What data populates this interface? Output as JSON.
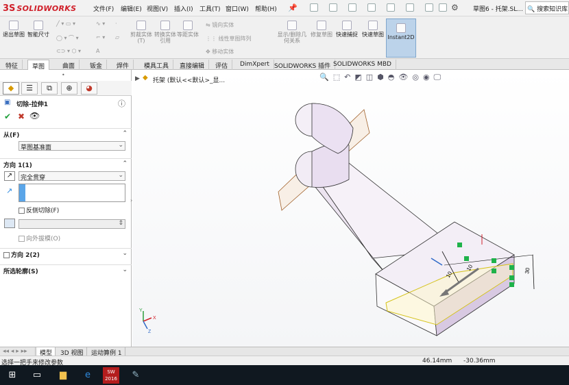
{
  "brand": {
    "logo_text": "SOLIDWORKS",
    "logo_mark": "3S"
  },
  "menubar": [
    "文件(F)",
    "编辑(E)",
    "视图(V)",
    "插入(I)",
    "工具(T)",
    "窗口(W)",
    "帮助(H)"
  ],
  "window": {
    "title": "草图6 - 托架.SL...",
    "search_placeholder": "搜索知识库"
  },
  "toolbar": {
    "left_buttons": [
      {
        "label": "退出草图"
      },
      {
        "label": "智能尺寸"
      }
    ],
    "mid_buttons": [
      {
        "label": "剪裁实体(T)"
      },
      {
        "label": "转换实体引用"
      },
      {
        "label": "等距实体"
      }
    ],
    "small_items": [
      "镜向实体",
      "线性草图阵列",
      "移动实体"
    ],
    "right_buttons": [
      {
        "label": "显示/删除几何关系"
      },
      {
        "label": "修复草图"
      },
      {
        "label": "快速捕捉"
      },
      {
        "label": "快速草图"
      },
      {
        "label": "Instant2D"
      }
    ]
  },
  "tabs": [
    "特征",
    "草图",
    "曲面",
    "钣金",
    "焊件",
    "模具工具",
    "直接编辑",
    "评估",
    "DimXpert",
    "SOLIDWORKS 插件",
    "SOLIDWORKS MBD"
  ],
  "active_tab": "草图",
  "tree_breadcrumb": "托架 (默认<<默认>_显...",
  "property_manager": {
    "title": "切除-拉伸1",
    "from": {
      "label": "从(F)",
      "value": "草图基准面"
    },
    "direction1": {
      "label": "方向 1(1)",
      "end_condition": "完全贯穿",
      "flip_side_label": "反侧切除(F)",
      "draft_label": "向外拔模(O)"
    },
    "direction2": {
      "label": "方向 2(2)"
    },
    "selected_contours": {
      "label": "所选轮廓(S)"
    }
  },
  "dimensions": [
    "10",
    "10",
    "30"
  ],
  "bottom_tabs": [
    "模型",
    "3D 视图",
    "运动算例 1"
  ],
  "active_bottom_tab": "模型",
  "status": {
    "message": "选择一把手来修改参数",
    "x": "46.14mm",
    "y": "-30.36mm"
  },
  "triad": {
    "x": "X",
    "y": "Y",
    "z": "Z"
  },
  "taskbar_badge": "SW 2016",
  "colors": {
    "accent": "#d0202a",
    "selection": "#2f8be0",
    "handle": "#1fb24a",
    "part": "#efe8f2"
  }
}
